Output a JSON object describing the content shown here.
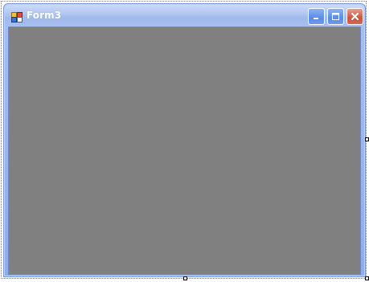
{
  "window": {
    "title": "Form3",
    "client_background": "#808080"
  },
  "titlebar": {
    "icon": "form-app-icon",
    "buttons": [
      {
        "name": "minimize",
        "icon": "minimize-icon"
      },
      {
        "name": "maximize",
        "icon": "maximize-icon"
      },
      {
        "name": "close",
        "icon": "close-icon"
      }
    ]
  },
  "colors": {
    "titlebar_text": "#ffffff",
    "frame": "#8eaee8",
    "close_button": "#c9553f",
    "client": "#808080"
  }
}
